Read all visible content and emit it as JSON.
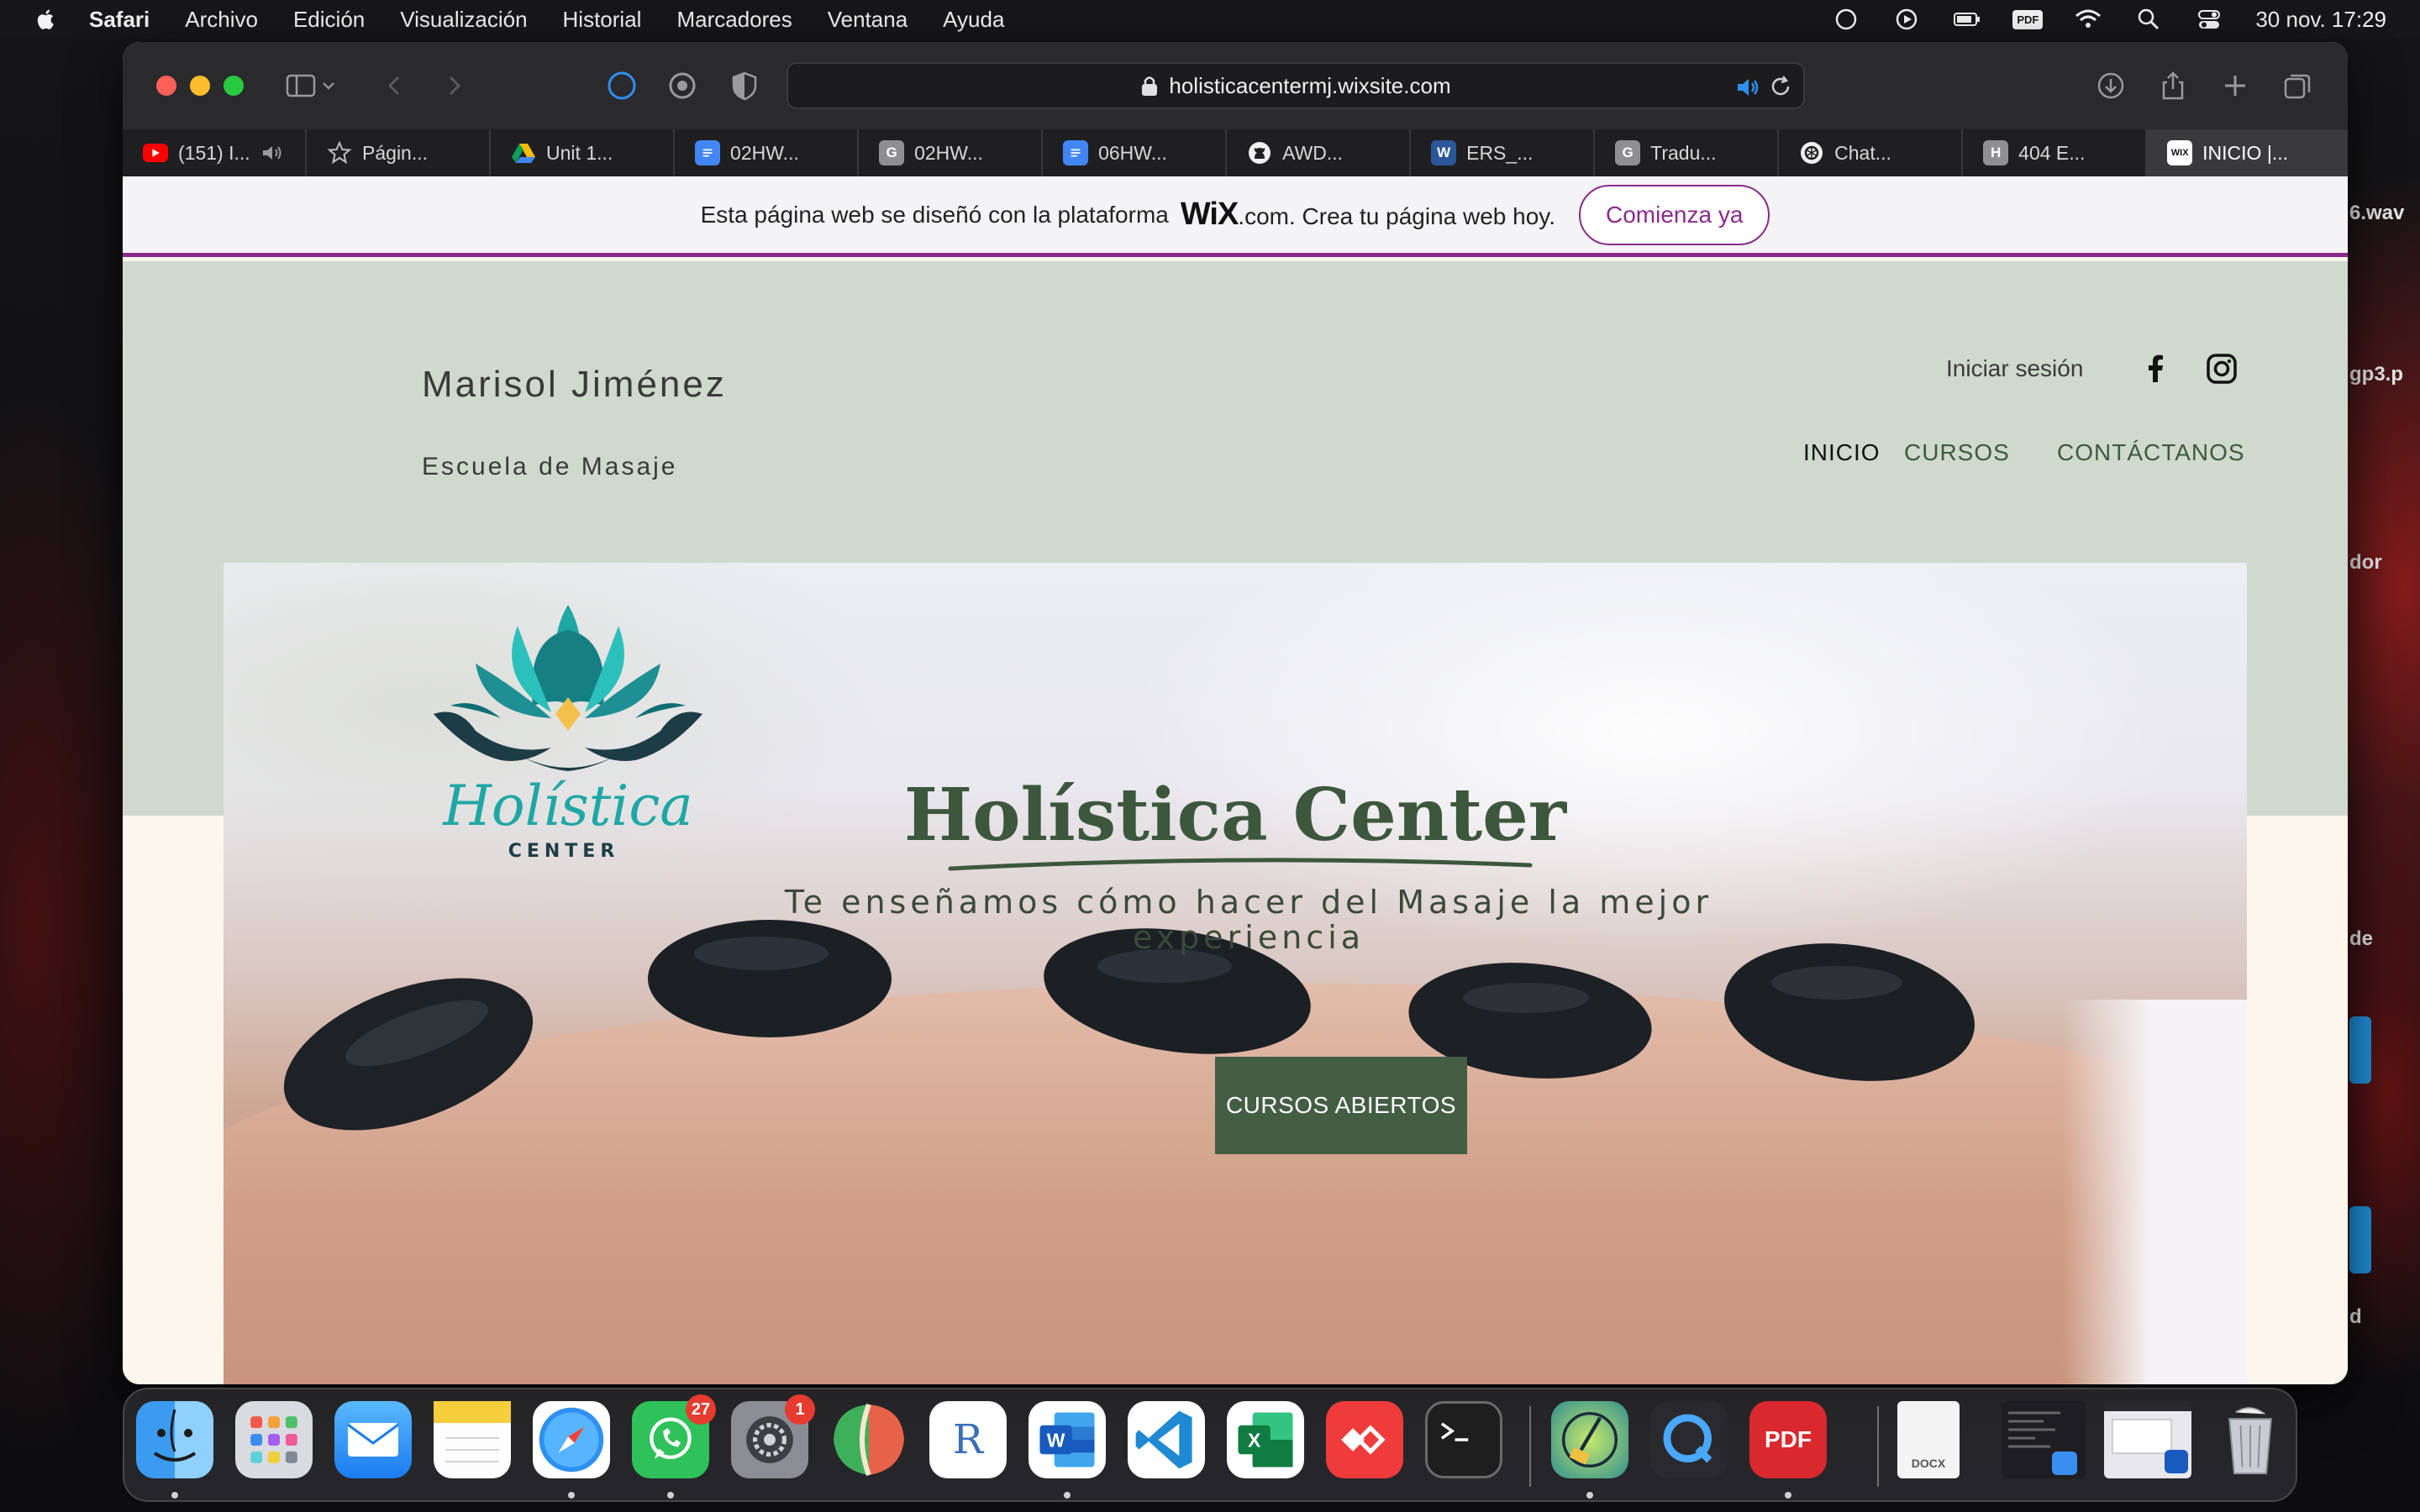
{
  "menubar": {
    "app_name": "Safari",
    "items": [
      "Archivo",
      "Edición",
      "Visualización",
      "Historial",
      "Marcadores",
      "Ventana",
      "Ayuda"
    ],
    "pdf_label": "PDF",
    "clock": "30 nov.  17:29"
  },
  "browser": {
    "url": "holisticacentermj.wixsite.com",
    "tabs": [
      {
        "label": "(151) I...",
        "icon": "youtube-icon"
      },
      {
        "label": "Págin...",
        "icon": "star-icon"
      },
      {
        "label": "Unit 1...",
        "icon": "google-drive-icon"
      },
      {
        "label": "02HW...",
        "icon": "google-docs-icon"
      },
      {
        "label": "02HW...",
        "icon": "g-icon"
      },
      {
        "label": "06HW...",
        "icon": "google-docs-icon"
      },
      {
        "label": "AWD...",
        "icon": "github-icon"
      },
      {
        "label": "ERS_...",
        "icon": "word-icon"
      },
      {
        "label": "Tradu...",
        "icon": "g-icon"
      },
      {
        "label": "Chat...",
        "icon": "chatgpt-icon"
      },
      {
        "label": "404 E...",
        "icon": "h-icon"
      },
      {
        "label": "INICIO |...",
        "icon": "wix-icon"
      }
    ],
    "fav_letters": {
      "g": "G",
      "h": "H",
      "w": "W",
      "wix": "WIX"
    }
  },
  "wix_banner": {
    "text_before": "Esta página web se diseñó con la plataforma",
    "logo": "WiX",
    "text_after": ".com. Crea tu página web hoy.",
    "cta": "Comienza ya"
  },
  "site": {
    "brand_name": "Marisol Jiménez",
    "brand_sub": "Escuela de Masaje",
    "login": "Iniciar sesión",
    "nav": [
      "INICIO",
      "CURSOS",
      "CONTÁCTANOS"
    ],
    "logo_text": "Holística",
    "logo_sub": "CENTER",
    "hero_title": "Holística Center",
    "hero_subtitle": "Te enseñamos cómo hacer del Masaje la mejor experiencia",
    "hero_button": "CURSOS ABIERTOS"
  },
  "desktop_labels": [
    "6.wav",
    "gp3.p",
    "dor",
    "de",
    "d"
  ],
  "dock": {
    "whatsapp_badge": "27",
    "settings_badge": "1",
    "r_letter": "R",
    "word_letter": "W",
    "excel_letter": "X",
    "pdf_letter": "PDF",
    "docx_label": "DOCX"
  },
  "colors": {
    "accent_purple": "#8b2a8b",
    "header_sage": "#d0d9ce",
    "brand_green": "#435e43",
    "page_cream": "#fdf6ec"
  }
}
